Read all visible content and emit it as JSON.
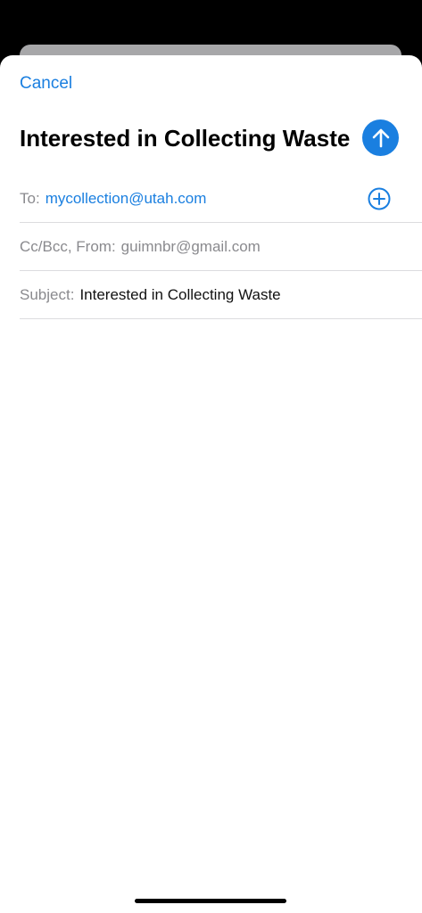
{
  "compose": {
    "cancel_label": "Cancel",
    "title": "Interested in Collecting Waste",
    "send_icon": "arrow-up-icon",
    "to": {
      "label": "To:",
      "value": "mycollection@utah.com",
      "add_icon": "plus-circle-icon"
    },
    "ccbcc": {
      "label": "Cc/Bcc, From:",
      "value": "guimnbr@gmail.com"
    },
    "subject": {
      "label": "Subject:",
      "value": "Interested in Collecting Waste"
    },
    "body_text": ""
  },
  "colors": {
    "accent": "#1a7fe0",
    "label_gray": "#8a8a8e",
    "divider": "#dcdcdf",
    "backdrop": "#000000",
    "background_card": "#a7a7a9"
  }
}
